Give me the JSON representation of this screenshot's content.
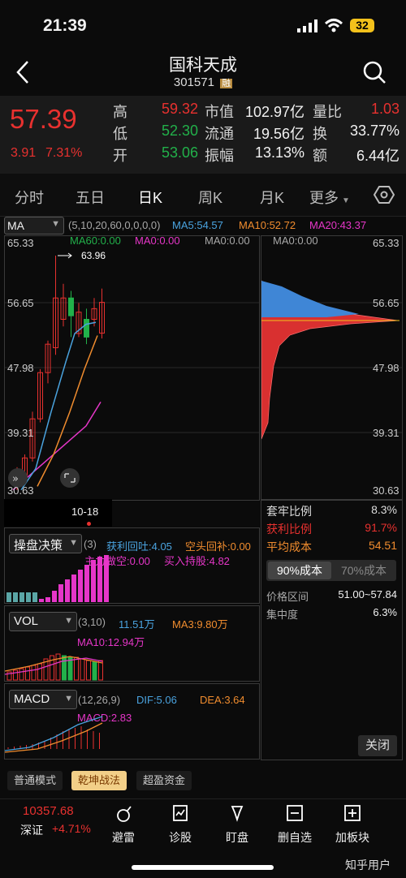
{
  "status": {
    "time": "21:39",
    "battery": "32"
  },
  "header": {
    "title": "国科天成",
    "code": "301571",
    "margin_badge": "融"
  },
  "quote": {
    "price": "57.39",
    "change": "3.91",
    "change_pct": "7.31%",
    "stats": [
      {
        "label": "高",
        "value": "59.32",
        "color": "#e8312f"
      },
      {
        "label": "低",
        "value": "52.30",
        "color": "#22b04a"
      },
      {
        "label": "开",
        "value": "53.06",
        "color": "#22b04a"
      },
      {
        "label": "市值",
        "value": "102.97亿",
        "color": "#f2f2f2"
      },
      {
        "label": "流通",
        "value": "19.56亿",
        "color": "#f2f2f2"
      },
      {
        "label": "振幅",
        "value": "13.13%",
        "color": "#f2f2f2"
      },
      {
        "label": "量比",
        "value": "1.03",
        "color": "#e8312f"
      },
      {
        "label": "换",
        "value": "33.77%",
        "color": "#f2f2f2"
      },
      {
        "label": "额",
        "value": "6.44亿",
        "color": "#f2f2f2"
      }
    ]
  },
  "tabs": [
    "分时",
    "五日",
    "日K",
    "周K",
    "月K",
    "更多"
  ],
  "active_tab": "日K",
  "ma_bar": {
    "selector": "MA",
    "params": "(5,10,20,60,0,0,0,0)",
    "ma5": "MA5:54.57",
    "ma10": "MA10:52.72",
    "ma20": "MA20:43.37",
    "ma60": "MA60:0.00",
    "ma0a": "MA0:0.00",
    "ma0b": "MA0:0.00",
    "ma0c": "MA0:0.00"
  },
  "kline": {
    "y_labels": [
      "65.33",
      "56.65",
      "47.98",
      "39.31",
      "30.63"
    ],
    "max_marker": "63.96",
    "date_label": "10-18"
  },
  "profile": {
    "y_labels": [
      "65.33",
      "56.65",
      "47.98",
      "39.31",
      "30.63"
    ],
    "rows": [
      {
        "label": "套牢比例",
        "value": "8.3%",
        "color": "#dddddd"
      },
      {
        "label": "获利比例",
        "value": "91.7%",
        "color": "#e8312f"
      },
      {
        "label": "平均成本",
        "value": "54.51",
        "color": "#f08c2e"
      }
    ],
    "cost_tabs": [
      "90%成本",
      "70%成本"
    ],
    "range_label": "价格区间",
    "range_value": "51.00~57.84",
    "conc_label": "集中度",
    "conc_value": "6.3%",
    "close_label": "关闭"
  },
  "decision": {
    "selector": "操盘决策",
    "param": "(3)",
    "items": [
      "获利回吐:4.05",
      "空头回补:0.00",
      "主力做空:0.00",
      "买入持股:4.82"
    ]
  },
  "vol": {
    "selector": "VOL",
    "param": "(3,10)",
    "value": "11.51万",
    "ma3": "MA3:9.80万",
    "ma10": "MA10:12.94万"
  },
  "macd": {
    "selector": "MACD",
    "param": "(12,26,9)",
    "dif": "DIF:5.06",
    "dea": "DEA:3.64",
    "macd": "MACD:2.83"
  },
  "modes": [
    "普通模式",
    "乾坤战法",
    "超盈资金"
  ],
  "active_mode": "乾坤战法",
  "index": {
    "value": "10357.68",
    "name": "深证",
    "change": "+4.71%"
  },
  "nav": [
    "避雷",
    "诊股",
    "盯盘",
    "删自选",
    "加板块"
  ],
  "watermark": "知乎用户",
  "colors": {
    "up": "#e8312f",
    "down": "#22b04a",
    "ma5": "#4aa3df",
    "ma10": "#f08c2e",
    "ma20": "#e636c8"
  }
}
